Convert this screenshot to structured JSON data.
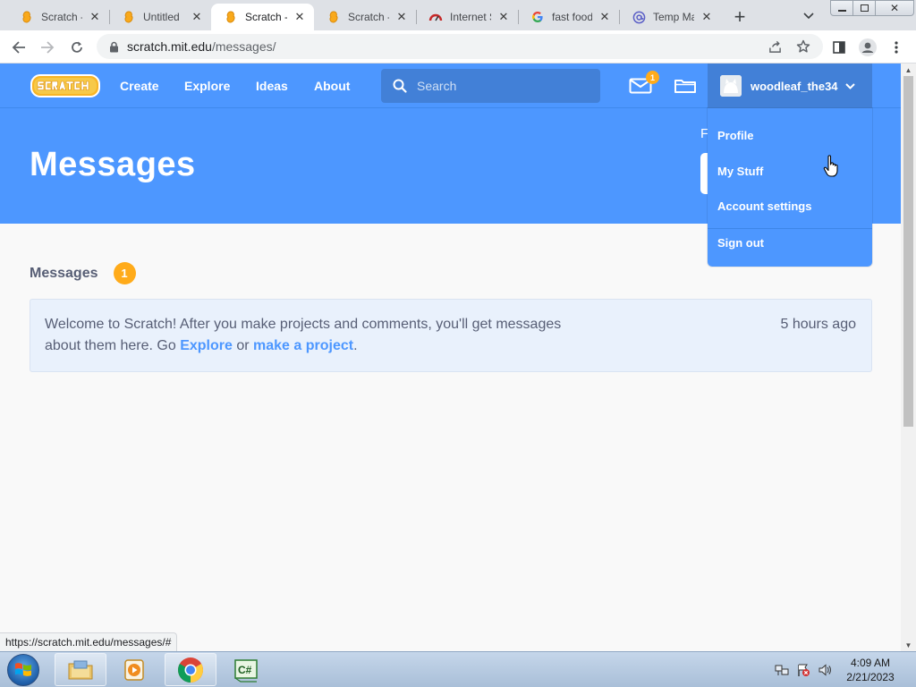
{
  "browser": {
    "tabs": [
      {
        "title": "Scratch -",
        "favicon": "scratch-cat-icon"
      },
      {
        "title": "Untitled",
        "favicon": "scratch-cat-icon"
      },
      {
        "title": "Scratch -",
        "favicon": "scratch-cat-icon",
        "active": true
      },
      {
        "title": "Scratch -",
        "favicon": "scratch-cat-icon"
      },
      {
        "title": "Internet S",
        "favicon": "speedometer-icon"
      },
      {
        "title": "fast food",
        "favicon": "google-icon"
      },
      {
        "title": "Temp Ma",
        "favicon": "at-sign-icon"
      }
    ],
    "url_host": "scratch.mit.edu",
    "url_path": "/messages/",
    "status_url": "https://scratch.mit.edu/messages/#"
  },
  "nav": {
    "links": [
      "Create",
      "Explore",
      "Ideas",
      "About"
    ],
    "search_placeholder": "Search",
    "message_count": "1",
    "username": "woodleaf_the34"
  },
  "dropdown": {
    "items": [
      "Profile",
      "My Stuff",
      "Account settings",
      "Sign out"
    ]
  },
  "banner": {
    "title": "Messages",
    "filter_label_partial": "F"
  },
  "messages": {
    "label": "Messages",
    "count": "1",
    "welcome": {
      "text_before": "Welcome to Scratch! After you make projects and comments, you'll get messages about them here. Go ",
      "link1": "Explore",
      "text_middle": " or ",
      "link2": "make a project",
      "text_after": ".",
      "time": "5 hours ago"
    }
  },
  "taskbar": {
    "time": "4:09 AM",
    "date": "2/21/2023"
  },
  "colors": {
    "scratch_blue": "#4d97ff",
    "scratch_dark_blue": "#4280d7",
    "badge_orange": "#ffab1a",
    "text_gray": "#575e75"
  }
}
